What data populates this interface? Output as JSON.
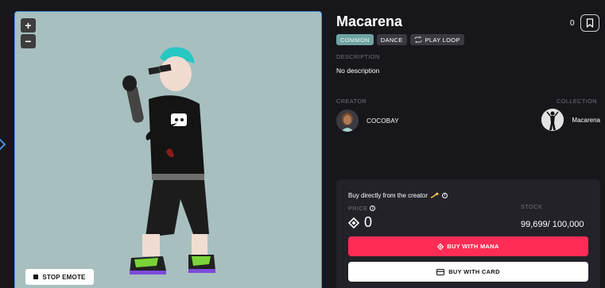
{
  "preview": {
    "zoom_in_label": "+",
    "zoom_out_label": "−",
    "stop_emote_label": "STOP EMOTE",
    "background_color": "#a8bfbf"
  },
  "item": {
    "title": "Macarena",
    "favorites_count": "0",
    "badges": {
      "rarity": "COMMON",
      "category": "DANCE",
      "play_mode": "PLAY LOOP"
    },
    "description_label": "DESCRIPTION",
    "description": "No description",
    "creator_label": "CREATOR",
    "creator_name": "COCOBAY",
    "collection_label": "COLLECTION",
    "collection_name": "Macarena"
  },
  "buy": {
    "title": "Buy directly from the creator",
    "price_label": "PRICE",
    "price_value": "0",
    "stock_label": "STOCK",
    "stock_value": "99,699/ 100,000",
    "buy_mana_label": "BUY WITH MANA",
    "buy_card_label": "BUY WITH CARD"
  },
  "colors": {
    "background": "#17161b",
    "card": "#242229",
    "accent": "#ff2d55",
    "rarity_common": "#6fa3a3",
    "muted_text": "#736e7d"
  },
  "icons": [
    "chevron-right-icon",
    "bookmark-icon",
    "loop-icon",
    "sparkle-icon",
    "info-icon",
    "mana-icon",
    "credit-card-icon",
    "stop-icon"
  ]
}
